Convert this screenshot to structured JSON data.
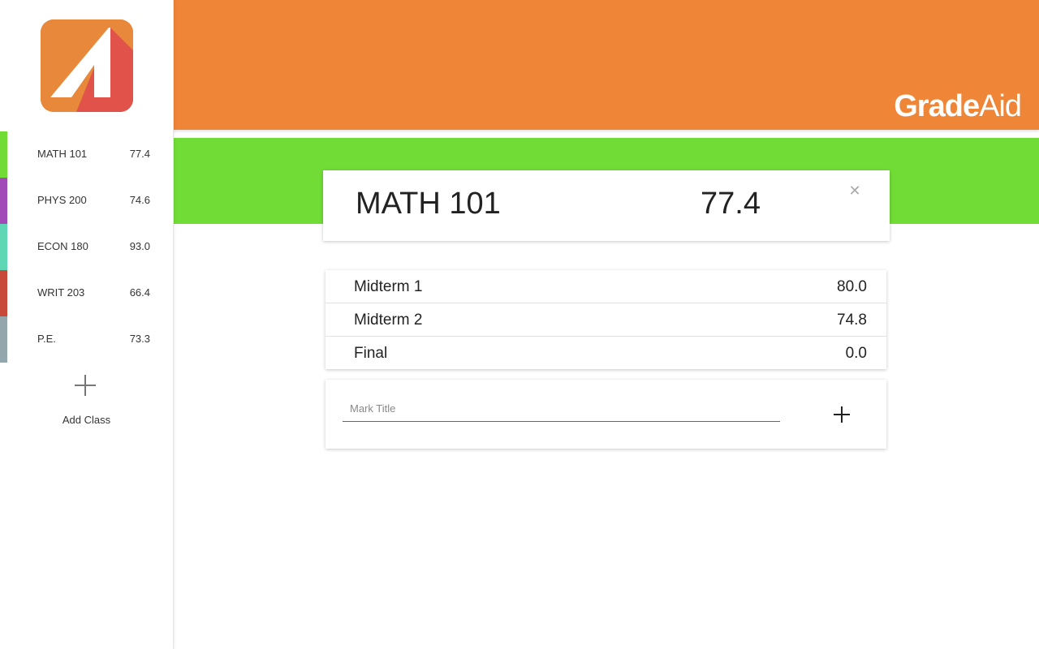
{
  "app": {
    "brand_bold": "Grade",
    "brand_light": "Aid",
    "logo_icon": "gradeaid-logo-icon"
  },
  "colors": {
    "header": "#ef8537",
    "band": "#72dc36",
    "logo_bg": "#e8883b",
    "logo_fg": "#e0524a"
  },
  "sidebar": {
    "classes": [
      {
        "name": "MATH 101",
        "grade": "77.4",
        "color": "#72dc36"
      },
      {
        "name": "PHYS 200",
        "grade": "74.6",
        "color": "#a24bb8"
      },
      {
        "name": "ECON 180",
        "grade": "93.0",
        "color": "#5fd6b4"
      },
      {
        "name": "WRIT 203",
        "grade": "66.4",
        "color": "#c8493a"
      },
      {
        "name": "P.E.",
        "grade": "73.3",
        "color": "#93a6ab"
      }
    ],
    "add_label": "Add Class",
    "add_icon": "plus-icon"
  },
  "current_class": {
    "title": "MATH 101",
    "average": "77.4",
    "close_icon": "close-icon"
  },
  "marks": [
    {
      "title": "Midterm 1",
      "value": "80.0"
    },
    {
      "title": "Midterm 2",
      "value": "74.8"
    },
    {
      "title": "Final",
      "value": "0.0"
    }
  ],
  "add_mark": {
    "placeholder": "Mark Title",
    "add_icon": "plus-icon"
  }
}
